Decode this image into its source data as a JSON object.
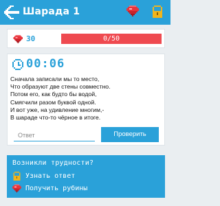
{
  "appbar": {
    "title": "Шарада 1",
    "back_icon": "pixel-arrow-back-icon",
    "ruby_icon": "ruby-icon",
    "lock_icon": "lock-icon"
  },
  "progress": {
    "rubies": "30",
    "progress_text": "0/50",
    "progress_fraction": 0
  },
  "riddle": {
    "timer": "00:06",
    "lines": [
      "Сначала записали мы то  место,",
      "Что образуют две стены совместно.",
      "Потом его, как будто бы водой,",
      "Смягчили разом буквой одной.",
      "И вот уже, на удивление многим,-",
      "В шараде что-то чёрное в итоге."
    ],
    "answer_placeholder": "Ответ",
    "answer_value": "",
    "check_label": "Проверить"
  },
  "help": {
    "title": "Возникли трудности?",
    "reveal_answer": "Узнать ответ",
    "get_rubies": "Получить рубины"
  },
  "colors": {
    "accent": "#2aa1d9",
    "progress_bar": "#ef4a50",
    "ruby": "#e8343c",
    "lock": "#f1b51c",
    "background": "#eaeef1"
  }
}
